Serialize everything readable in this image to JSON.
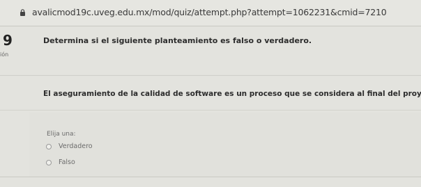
{
  "browser": {
    "url": "avalicmod19c.uveg.edu.mx/mod/quiz/attempt.php?attempt=1062231&cmid=7210",
    "lock_icon": "lock-icon"
  },
  "question": {
    "number": "9",
    "side_label": "ión",
    "prompt": "Determina si el siguiente planteamiento es falso o verdadero.",
    "text": "El aseguramiento de la calidad de software es un proceso que se considera al final del proyecto",
    "choose_label": "Elija una:",
    "options": [
      {
        "label": "Verdadero"
      },
      {
        "label": "Falso"
      }
    ]
  }
}
